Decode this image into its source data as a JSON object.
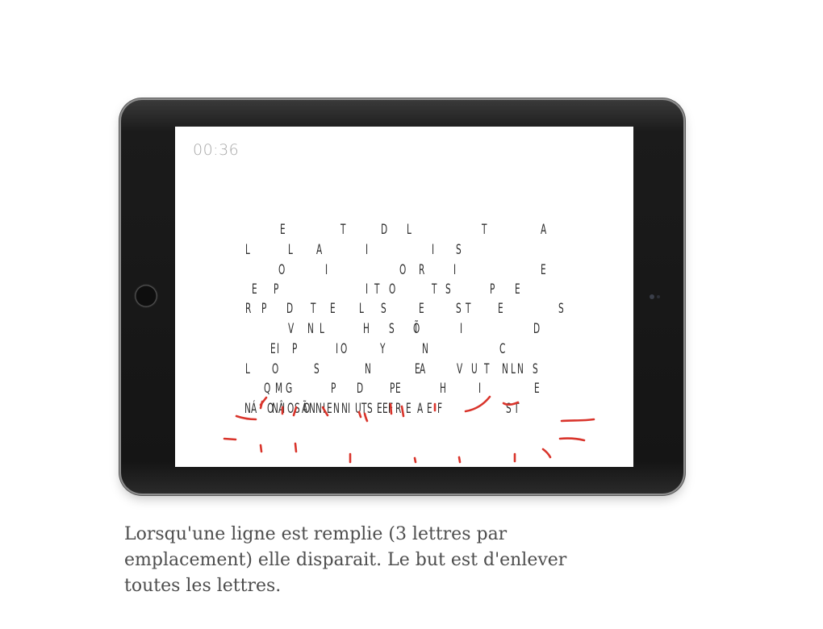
{
  "game": {
    "timer": "00:36",
    "grid_rows": [
      [
        "E",
        "T",
        "D",
        "L",
        "T",
        "A"
      ],
      [
        "L",
        "L",
        "A",
        "I",
        "I",
        "S"
      ],
      [
        "O",
        "I",
        "O",
        "R",
        "I",
        "E"
      ],
      [
        "E",
        "P",
        "I",
        "T",
        "O",
        "T",
        "S",
        "P",
        "E"
      ],
      [
        "R",
        "P",
        "D",
        "T",
        "E",
        "L",
        "S",
        "E",
        "S",
        "T",
        "E",
        "S"
      ],
      [
        "V",
        "N",
        "L",
        "H",
        "S",
        "Õ",
        "I",
        "I",
        "D"
      ],
      [
        "E",
        "I",
        "P",
        "I",
        "O",
        "Y",
        "N",
        "C"
      ],
      [
        "L",
        "O",
        "S",
        "N",
        "E",
        "A",
        "V",
        "U",
        "T",
        "N",
        "L",
        "N",
        "S"
      ],
      [
        "Q",
        "M",
        "G",
        "P",
        "D",
        "P",
        "E",
        "H",
        "I",
        "E"
      ],
      [
        "N",
        "Á",
        "O",
        "N",
        "Â",
        "I",
        "O",
        "S",
        "Ã",
        "O",
        "N",
        "N",
        "I",
        "E",
        "N",
        "N",
        "I",
        "U",
        "T",
        "S",
        "E",
        "E",
        "F",
        "R",
        "E",
        "A",
        "E",
        "F",
        "S",
        "T"
      ]
    ],
    "stroke_color": "#d9342b",
    "letter_color": "#2e2e2e"
  },
  "caption": {
    "line1": "Lorsqu'une ligne est remplie (3 lettres par",
    "line2": "emplacement) elle disparait. Le but est d'enlever",
    "line3": "toutes les lettres."
  }
}
